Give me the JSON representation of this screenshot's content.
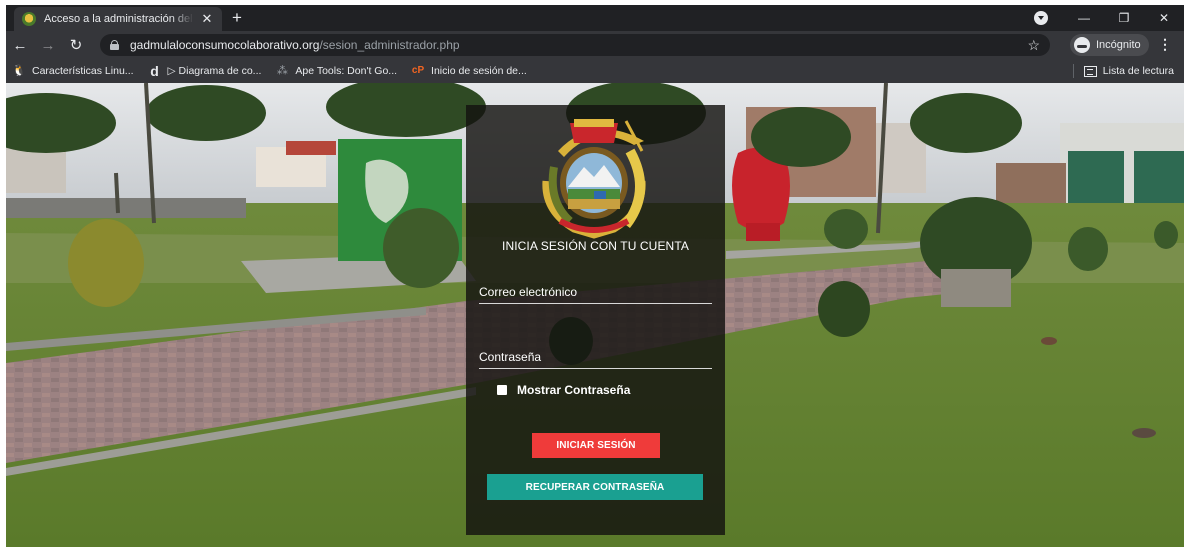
{
  "browser": {
    "tab_title": "Acceso a la administración del co",
    "tab_close": "✕",
    "new_tab": "+",
    "window_controls": {
      "minimize": "—",
      "restore": "❐",
      "close": "✕"
    },
    "url_domain": "gadmulaloconsumocolaborativo.org",
    "url_path": "/sesion_administrador.php",
    "incognito_label": "Incógnito",
    "bookmarks": [
      {
        "icon": "tux-icon",
        "label": "Características Linu..."
      },
      {
        "icon": "d-logo-icon",
        "label": "▷ Diagrama de co..."
      },
      {
        "icon": "ape-icon",
        "label": "Ape Tools: Don't Go..."
      },
      {
        "icon": "cp-icon",
        "label": "Inicio de sesión de..."
      }
    ],
    "reading_list": "Lista de lectura"
  },
  "login": {
    "heading": "INICIA SESIÓN CON TU CUENTA",
    "email_placeholder": "Correo electrónico",
    "password_placeholder": "Contraseña",
    "show_password_label": "Mostrar Contraseña",
    "login_button": "INICIAR SESIÓN",
    "recover_button": "RECUPERAR CONTRASEÑA"
  },
  "colors": {
    "login_button": "#ef3b3a",
    "recover_button": "#1aa091",
    "card_bg": "rgba(20,18,16,0.82)"
  }
}
